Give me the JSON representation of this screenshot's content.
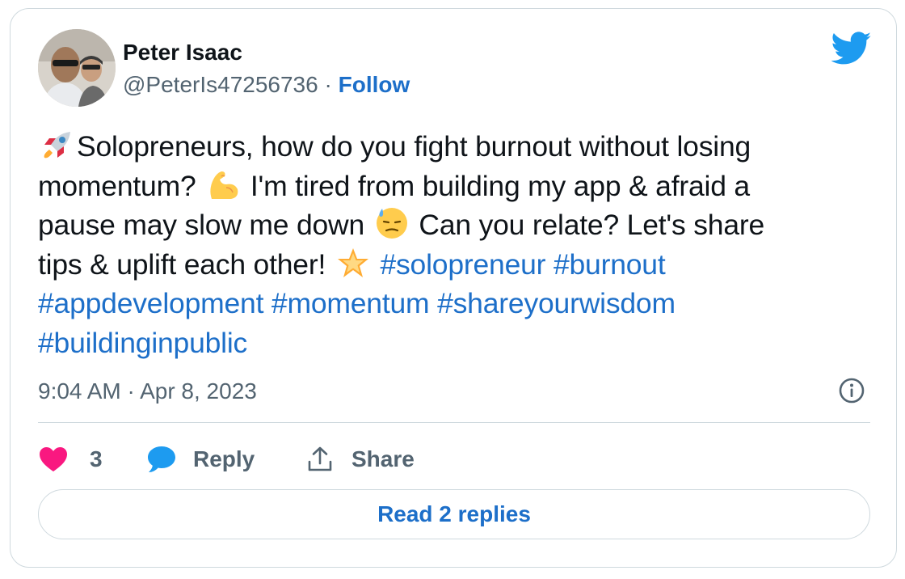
{
  "user": {
    "name": "Peter Isaac",
    "handle": "@PeterIs47256736",
    "separator": "·",
    "follow_label": "Follow"
  },
  "tweet": {
    "line1": "Solopreneurs, how do you fight burnout without losing",
    "line2_a": "momentum?",
    "line2_b": "I'm tired from building my app & afraid a",
    "line3_a": "pause may slow me down",
    "line3_b": "Can you relate? Let's share",
    "line4_a": "tips & uplift each other!",
    "hashtags": [
      "#solopreneur",
      "#burnout",
      "#appdevelopment",
      "#momentum",
      "#shareyourwisdom",
      "#buildinginpublic"
    ],
    "emojis": [
      "rocket-emoji",
      "flexed-biceps-emoji",
      "downcast-face-sweat-emoji",
      "glowing-star-emoji"
    ]
  },
  "meta": {
    "time": "9:04 AM",
    "separator": "·",
    "date": "Apr 8, 2023"
  },
  "actions": {
    "like_count": "3",
    "reply_label": "Reply",
    "share_label": "Share"
  },
  "read_replies_label": "Read 2 replies",
  "icons": [
    "twitter-bird-icon",
    "info-icon",
    "heart-icon",
    "reply-bubble-icon",
    "share-icon"
  ],
  "colors": {
    "link": "#1d6fc9",
    "twitter_blue": "#1d9bf0",
    "heart": "#f91880",
    "muted": "#536471",
    "border": "#cfd9de",
    "text": "#0f1419"
  }
}
